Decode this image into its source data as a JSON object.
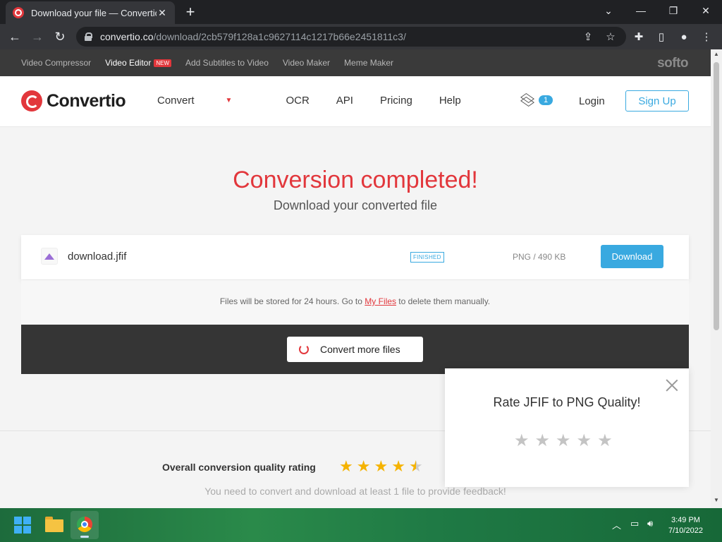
{
  "browser": {
    "tab_title": "Download your file — Convertio",
    "url_host": "convertio.co",
    "url_path": "/download/2cb579f128a1c9627114c1217b66e2451811c3/"
  },
  "softo_bar": {
    "links": [
      {
        "label": "Video Compressor"
      },
      {
        "label": "Video Editor",
        "badge": "NEW"
      },
      {
        "label": "Add Subtitles to Video"
      },
      {
        "label": "Video Maker"
      },
      {
        "label": "Meme Maker"
      }
    ],
    "brand": "softo"
  },
  "header": {
    "logo_text": "Convertio",
    "nav": [
      "Convert",
      "OCR",
      "API",
      "Pricing",
      "Help"
    ],
    "layers_count": "1",
    "login": "Login",
    "signup": "Sign Up"
  },
  "hero": {
    "title": "Conversion completed!",
    "subtitle": "Download your converted file"
  },
  "file": {
    "name": "download.jfif",
    "status": "FINISHED",
    "info": "PNG / 490 KB",
    "download_label": "Download"
  },
  "notice": {
    "before": "Files will be stored for 24 hours. Go to ",
    "link": "My Files",
    "after": " to delete them manually."
  },
  "convert_more": "Convert more files",
  "rating": {
    "label": "Overall conversion quality rating",
    "value": 4.5,
    "max": 5,
    "note": "You need to convert and download at least 1 file to provide feedback!"
  },
  "popup": {
    "title": "Rate JFIF to PNG Quality!",
    "stars": 5
  },
  "taskbar": {
    "time": "3:49 PM",
    "date": "7/10/2022"
  },
  "colors": {
    "brand_red": "#e2373c",
    "accent_blue": "#39a9e0",
    "star_gold": "#f5b301"
  }
}
